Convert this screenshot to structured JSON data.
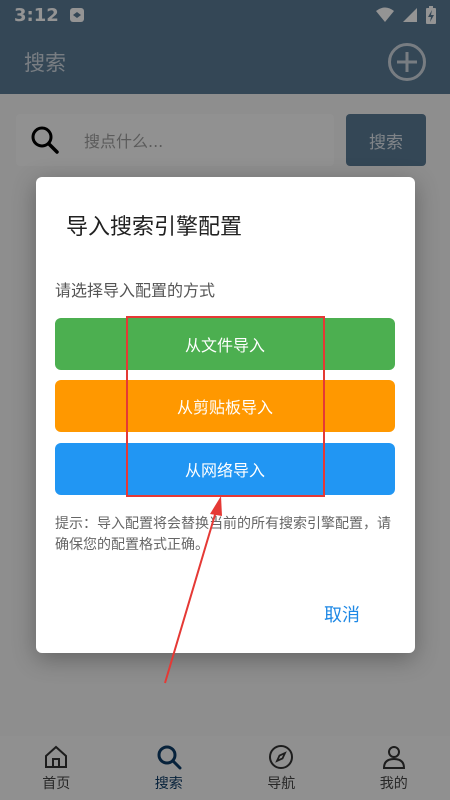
{
  "status_bar": {
    "time": "3:12"
  },
  "app_bar": {
    "title": "搜索"
  },
  "search": {
    "placeholder": "搜点什么...",
    "button_label": "搜索"
  },
  "dialog": {
    "title": "导入搜索引擎配置",
    "prompt": "请选择导入配置的方式",
    "options": [
      {
        "label": "从文件导入",
        "color": "#4caf50"
      },
      {
        "label": "从剪贴板导入",
        "color": "#ff9800"
      },
      {
        "label": "从网络导入",
        "color": "#2196f3"
      }
    ],
    "tip": "提示：导入配置将会替换当前的所有搜索引擎配置，请确保您的配置格式正确。",
    "cancel_label": "取消"
  },
  "bottom_nav": {
    "items": [
      {
        "label": "首页",
        "icon": "home-icon"
      },
      {
        "label": "搜索",
        "icon": "search-icon",
        "active": true
      },
      {
        "label": "导航",
        "icon": "compass-icon"
      },
      {
        "label": "我的",
        "icon": "person-icon"
      }
    ]
  },
  "colors": {
    "primary": "#5a7a95",
    "annotation": "#e53935"
  }
}
